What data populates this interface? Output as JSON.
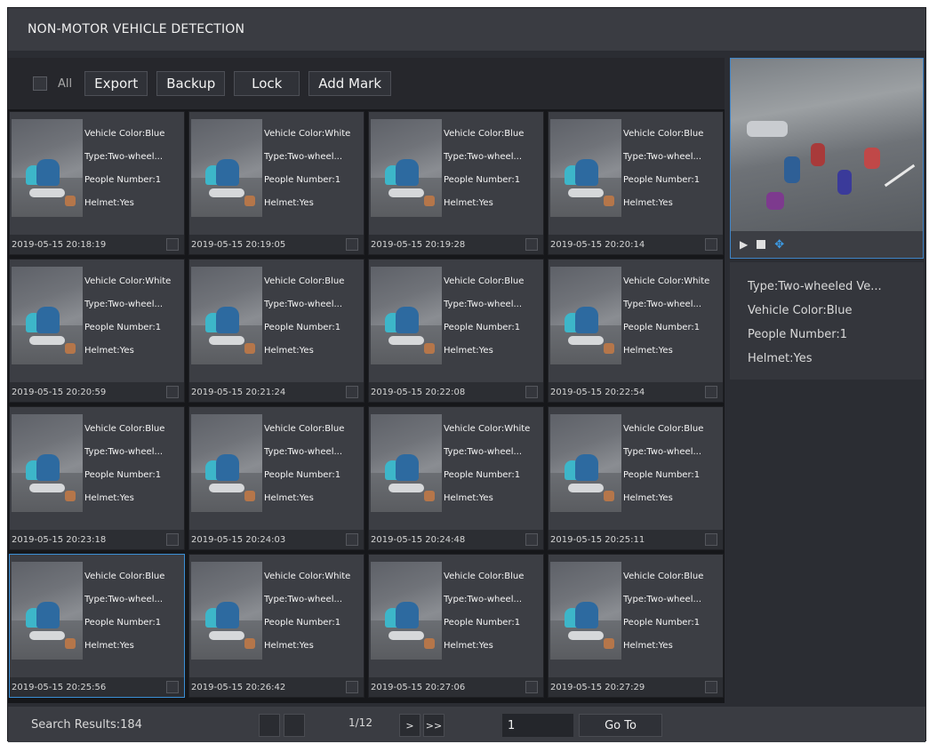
{
  "window": {
    "title": "NON-MOTOR VEHICLE DETECTION"
  },
  "toolbar": {
    "all_label": "All",
    "export_label": "Export",
    "backup_label": "Backup",
    "lock_label": "Lock",
    "add_mark_label": "Add Mark"
  },
  "results": [
    {
      "color": "Vehicle Color:Blue",
      "type": "Type:Two-wheel...",
      "people": "People Number:1",
      "helmet": "Helmet:Yes",
      "time": "2019-05-15 20:18:19"
    },
    {
      "color": "Vehicle Color:White",
      "type": "Type:Two-wheel...",
      "people": "People Number:1",
      "helmet": "Helmet:Yes",
      "time": "2019-05-15 20:19:05"
    },
    {
      "color": "Vehicle Color:Blue",
      "type": "Type:Two-wheel...",
      "people": "People Number:1",
      "helmet": "Helmet:Yes",
      "time": "2019-05-15 20:19:28"
    },
    {
      "color": "Vehicle Color:Blue",
      "type": "Type:Two-wheel...",
      "people": "People Number:1",
      "helmet": "Helmet:Yes",
      "time": "2019-05-15 20:20:14"
    },
    {
      "color": "Vehicle Color:White",
      "type": "Type:Two-wheel...",
      "people": "People Number:1",
      "helmet": "Helmet:Yes",
      "time": "2019-05-15 20:20:59"
    },
    {
      "color": "Vehicle Color:Blue",
      "type": "Type:Two-wheel...",
      "people": "People Number:1",
      "helmet": "Helmet:Yes",
      "time": "2019-05-15 20:21:24"
    },
    {
      "color": "Vehicle Color:Blue",
      "type": "Type:Two-wheel...",
      "people": "People Number:1",
      "helmet": "Helmet:Yes",
      "time": "2019-05-15 20:22:08"
    },
    {
      "color": "Vehicle Color:White",
      "type": "Type:Two-wheel...",
      "people": "People Number:1",
      "helmet": "Helmet:Yes",
      "time": "2019-05-15 20:22:54"
    },
    {
      "color": "Vehicle Color:Blue",
      "type": "Type:Two-wheel...",
      "people": "People Number:1",
      "helmet": "Helmet:Yes",
      "time": "2019-05-15 20:23:18"
    },
    {
      "color": "Vehicle Color:Blue",
      "type": "Type:Two-wheel...",
      "people": "People Number:1",
      "helmet": "Helmet:Yes",
      "time": "2019-05-15 20:24:03"
    },
    {
      "color": "Vehicle Color:White",
      "type": "Type:Two-wheel...",
      "people": "People Number:1",
      "helmet": "Helmet:Yes",
      "time": "2019-05-15 20:24:48"
    },
    {
      "color": "Vehicle Color:Blue",
      "type": "Type:Two-wheel...",
      "people": "People Number:1",
      "helmet": "Helmet:Yes",
      "time": "2019-05-15 20:25:11"
    },
    {
      "color": "Vehicle Color:Blue",
      "type": "Type:Two-wheel...",
      "people": "People Number:1",
      "helmet": "Helmet:Yes",
      "time": "2019-05-15 20:25:56"
    },
    {
      "color": "Vehicle Color:White",
      "type": "Type:Two-wheel...",
      "people": "People Number:1",
      "helmet": "Helmet:Yes",
      "time": "2019-05-15 20:26:42"
    },
    {
      "color": "Vehicle Color:Blue",
      "type": "Type:Two-wheel...",
      "people": "People Number:1",
      "helmet": "Helmet:Yes",
      "time": "2019-05-15 20:27:06"
    },
    {
      "color": "Vehicle Color:Blue",
      "type": "Type:Two-wheel...",
      "people": "People Number:1",
      "helmet": "Helmet:Yes",
      "time": "2019-05-15 20:27:29"
    }
  ],
  "selected_index": 12,
  "preview": {
    "controls": [
      "play-icon",
      "stop-icon",
      "fisheye-icon"
    ]
  },
  "details": {
    "type": "Type:Two-wheeled Ve...",
    "color": "Vehicle Color:Blue",
    "people": "People Number:1",
    "helmet": "Helmet:Yes"
  },
  "footer": {
    "results_text": "Search Results:184",
    "page_indicator": "1/12",
    "next_label": ">",
    "last_label": ">>",
    "page_input_value": "1",
    "goto_label": "Go To"
  },
  "colors": {
    "accent": "#3a8fd6",
    "background": "#2b2d33",
    "title_bar": "#3a3c42"
  }
}
